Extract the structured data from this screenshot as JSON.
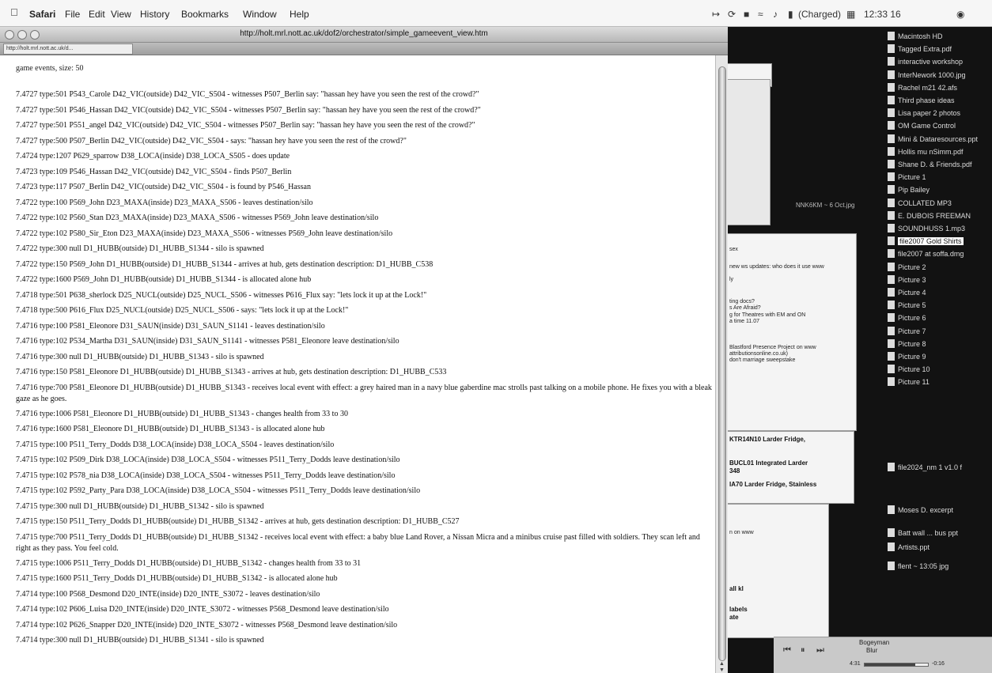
{
  "menubar": {
    "app": "Safari",
    "items": [
      "File",
      "Edit",
      "View",
      "History",
      "Bookmarks",
      "Window",
      "Help"
    ],
    "battery": "(Charged)",
    "clock": "12:33 16"
  },
  "window": {
    "title": "http://holt.mrl.nott.ac.uk/dof2/orchestrator/simple_gameevent_view.htm",
    "tab_label": "http://holt.mrl.nott.ac.uk/d..."
  },
  "page": {
    "header": "game events, size: 50",
    "events": [
      "7.4727 type:501 P543_Carole D42_VIC(outside) D42_VIC_S504 - witnesses P507_Berlin say: \"hassan hey have you seen the rest of the crowd?\"",
      "7.4727 type:501 P546_Hassan D42_VIC(outside) D42_VIC_S504 - witnesses P507_Berlin say: \"hassan hey have you seen the rest of the crowd?\"",
      "7.4727 type:501 P551_angel D42_VIC(outside) D42_VIC_S504 - witnesses P507_Berlin say: \"hassan hey have you seen the rest of the crowd?\"",
      "7.4727 type:500 P507_Berlin D42_VIC(outside) D42_VIC_S504 - says: \"hassan hey have you seen the rest of the crowd?\"",
      "7.4724 type:1207 P629_sparrow D38_LOCA(inside) D38_LOCA_S505 - does update",
      "7.4723 type:109 P546_Hassan D42_VIC(outside) D42_VIC_S504 - finds P507_Berlin",
      "7.4723 type:117 P507_Berlin D42_VIC(outside) D42_VIC_S504 - is found by P546_Hassan",
      "7.4722 type:100 P569_John D23_MAXA(inside) D23_MAXA_S506 - leaves destination/silo",
      "7.4722 type:102 P560_Stan D23_MAXA(inside) D23_MAXA_S506 - witnesses P569_John leave destination/silo",
      "7.4722 type:102 P580_Sir_Eton D23_MAXA(inside) D23_MAXA_S506 - witnesses P569_John leave destination/silo",
      "7.4722 type:300 null D1_HUBB(outside) D1_HUBB_S1344 - silo is spawned",
      "7.4722 type:150 P569_John D1_HUBB(outside) D1_HUBB_S1344 - arrives at hub, gets destination description: D1_HUBB_C538",
      "7.4722 type:1600 P569_John D1_HUBB(outside) D1_HUBB_S1344 - is allocated alone hub",
      "7.4718 type:501 P638_sherlock D25_NUCL(outside) D25_NUCL_S506 - witnesses P616_Flux say: \"lets lock it up at the Lock!\"",
      "7.4718 type:500 P616_Flux D25_NUCL(outside) D25_NUCL_S506 - says: \"lets lock it up at the Lock!\"",
      "7.4716 type:100 P581_Eleonore D31_SAUN(inside) D31_SAUN_S1141 - leaves destination/silo",
      "7.4716 type:102 P534_Martha D31_SAUN(inside) D31_SAUN_S1141 - witnesses P581_Eleonore leave destination/silo",
      "7.4716 type:300 null D1_HUBB(outside) D1_HUBB_S1343 - silo is spawned",
      "7.4716 type:150 P581_Eleonore D1_HUBB(outside) D1_HUBB_S1343 - arrives at hub, gets destination description: D1_HUBB_C533",
      "7.4716 type:700 P581_Eleonore D1_HUBB(outside) D1_HUBB_S1343 - receives local event with effect: a grey haired man in a navy blue gaberdine mac strolls past talking on a mobile phone. He fixes you with a bleak gaze as he goes.",
      "7.4716 type:1006 P581_Eleonore D1_HUBB(outside) D1_HUBB_S1343 - changes health from 33 to 30",
      "7.4716 type:1600 P581_Eleonore D1_HUBB(outside) D1_HUBB_S1343 - is allocated alone hub",
      "7.4715 type:100 P511_Terry_Dodds D38_LOCA(inside) D38_LOCA_S504 - leaves destination/silo",
      "7.4715 type:102 P509_Dirk D38_LOCA(inside) D38_LOCA_S504 - witnesses P511_Terry_Dodds leave destination/silo",
      "7.4715 type:102 P578_nia D38_LOCA(inside) D38_LOCA_S504 - witnesses P511_Terry_Dodds leave destination/silo",
      "7.4715 type:102 P592_Party_Para D38_LOCA(inside) D38_LOCA_S504 - witnesses P511_Terry_Dodds leave destination/silo",
      "7.4715 type:300 null D1_HUBB(outside) D1_HUBB_S1342 - silo is spawned",
      "7.4715 type:150 P511_Terry_Dodds D1_HUBB(outside) D1_HUBB_S1342 - arrives at hub, gets destination description: D1_HUBB_C527",
      "7.4715 type:700 P511_Terry_Dodds D1_HUBB(outside) D1_HUBB_S1342 - receives local event with effect: a baby blue Land Rover, a Nissan Micra and a minibus cruise past filled with soldiers. They scan left and right as they pass. You feel cold.",
      "7.4715 type:1006 P511_Terry_Dodds D1_HUBB(outside) D1_HUBB_S1342 - changes health from 33 to 31",
      "7.4715 type:1600 P511_Terry_Dodds D1_HUBB(outside) D1_HUBB_S1342 - is allocated alone hub",
      "7.4714 type:100 P568_Desmond D20_INTE(inside) D20_INTE_S3072 - leaves destination/silo",
      "7.4714 type:102 P606_Luisa D20_INTE(inside) D20_INTE_S3072 - witnesses P568_Desmond leave destination/silo",
      "7.4714 type:102 P626_Snapper D20_INTE(inside) D20_INTE_S3072 - witnesses P568_Desmond leave destination/silo",
      "7.4714 type:300 null D1_HUBB(outside) D1_HUBB_S1341 - silo is spawned"
    ]
  },
  "desktop_icons": [
    "Macintosh HD",
    "Tagged Extra.pdf",
    "interactive workshop",
    "InterNework 1000.jpg",
    "Rachel m21 42.afs",
    "Third phase ideas",
    "Lisa paper 2 photos",
    "OM Game Control",
    "Mini & Dataresources.ppt",
    "Hollis mu nSimm.pdf",
    "Shane D. & Friends.pdf",
    "Picture 1",
    "Pip Bailey",
    "COLLATED MP3",
    "E. DUBOIS FREEMAN",
    "SOUNDHUSS 1.mp3",
    "file2007 Gold Shirts",
    "file2007 at soffa.dmg",
    "Picture 2",
    "Picture 3",
    "Picture 4",
    "Picture 5",
    "Picture 6",
    "Picture 7",
    "Picture 8",
    "Picture 9",
    "Picture 10",
    "Picture 11"
  ],
  "lower_icons": [
    "file2024_nm 1 v1.0 f",
    "Moses D. excerpt",
    "Batt wall ... bus ppt",
    "Artists.ppt",
    "flent ~ 13:05 jpg"
  ],
  "bg_windows": {
    "fridge_lines": [
      "KTR14N10 Larder Fridge,",
      "BUCL01 Integrated Larder",
      "348",
      "IA70 Larder Fridge, Stainless"
    ],
    "misc": [
      "n on www",
      "all kl",
      "labels",
      "ate"
    ],
    "stray_label": "NNK6KM ~ 6 Oct.jpg",
    "email_lines": [
      "sex",
      "new ws updates: who does it use www",
      "ly",
      "ting docs?",
      "s Are Afraid?",
      "g for Theatres with EM and ON",
      "a time 11.07",
      "Blastford Presence Project on www",
      "attributionsonline.co.uk)",
      "don't marriage sweepstake"
    ]
  },
  "itunes": {
    "song": "Bogeyman",
    "artist": "Blur",
    "elapsed": "4:31",
    "remaining": "-0:16",
    "progress": 0.8
  }
}
